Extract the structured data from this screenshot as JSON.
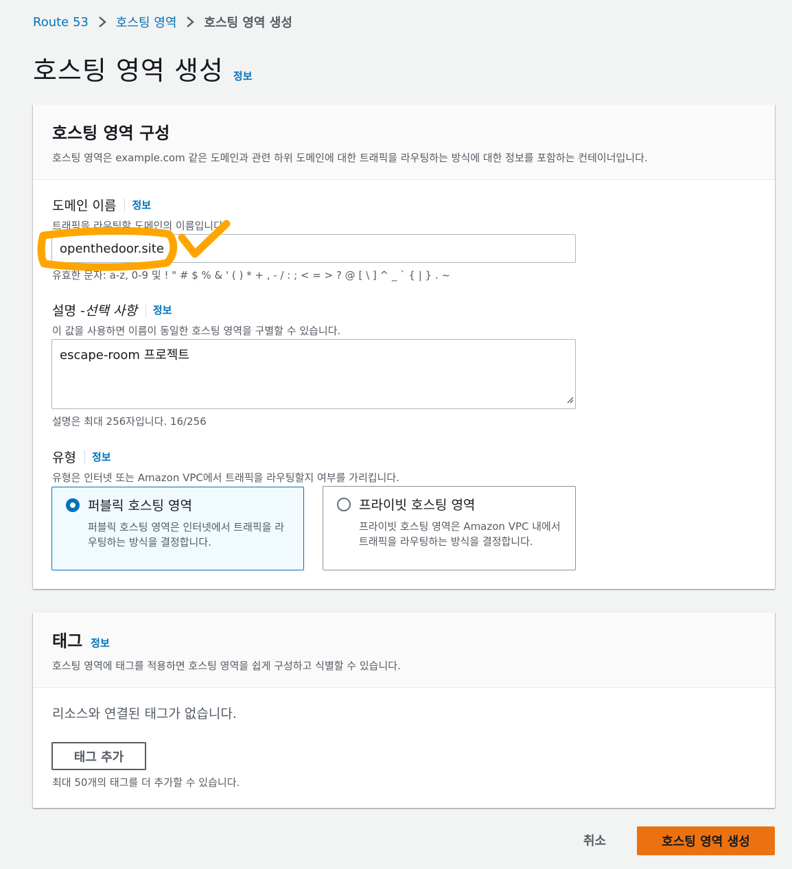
{
  "breadcrumb": {
    "items": [
      "Route 53",
      "호스팅 영역"
    ],
    "current": "호스팅 영역 생성"
  },
  "page": {
    "title": "호스팅 영역 생성",
    "info_label": "정보"
  },
  "config_panel": {
    "title": "호스팅 영역 구성",
    "description": "호스팅 영역은 example.com 같은 도메인과 관련 하위 도메인에 대한 트래픽을 라우팅하는 방식에 대한 정보를 포함하는 컨테이너입니다.",
    "domain": {
      "label": "도메인 이름",
      "info_label": "정보",
      "hint": "트래픽을 라우팅할 도메인의 이름입니다.",
      "value": "openthedoor.site",
      "constraint": "유효한 문자: a-z, 0-9 및 ! \" # $ % & ' ( ) * + , - / : ; < = > ? @ [ \\ ] ^ _ ` { | } . ~"
    },
    "description_field": {
      "label_main": "설명 - ",
      "label_optional": "선택 사항",
      "info_label": "정보",
      "hint": "이 값을 사용하면 이름이 동일한 호스팅 영역을 구별할 수 있습니다.",
      "value": "escape-room 프로젝트",
      "constraint": "설명은 최대 256자입니다. 16/256"
    },
    "type": {
      "label": "유형",
      "info_label": "정보",
      "hint": "유형은 인터넷 또는 Amazon VPC에서 트래픽을 라우팅할지 여부를 가리킵니다.",
      "options": [
        {
          "title": "퍼블릭 호스팅 영역",
          "description": "퍼블릭 호스팅 영역은 인터넷에서 트래픽을 라우팅하는 방식을 결정합니다."
        },
        {
          "title": "프라이빗 호스팅 영역",
          "description": "프라이빗 호스팅 영역은 Amazon VPC 내에서 트래픽을 라우팅하는 방식을 결정합니다."
        }
      ]
    }
  },
  "tags_panel": {
    "title": "태그",
    "info_label": "정보",
    "description": "호스팅 영역에 태그를 적용하면 호스팅 영역을 쉽게 구성하고 식별할 수 있습니다.",
    "empty_text": "리소스와 연결된 태그가 없습니다.",
    "add_button": "태그 추가",
    "limit_hint": "최대 50개의 태그를 더 추가할 수 있습니다."
  },
  "footer": {
    "cancel": "취소",
    "submit": "호스팅 영역 생성"
  },
  "colors": {
    "link": "#0073bb",
    "primary": "#ec7211",
    "annotation": "#ffa500"
  }
}
